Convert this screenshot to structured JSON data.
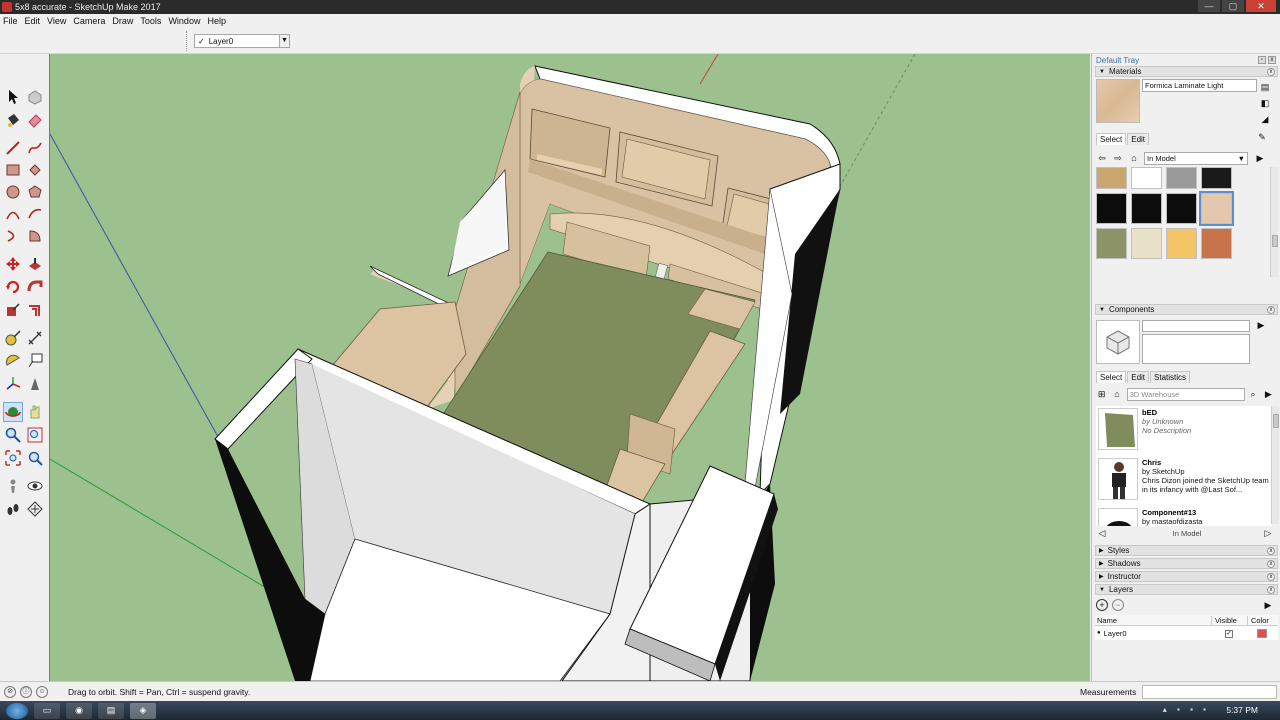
{
  "window": {
    "title": "5x8 accurate - SketchUp Make 2017",
    "minimize": "—",
    "maximize": "▢",
    "close": "✕"
  },
  "menu": [
    "File",
    "Edit",
    "View",
    "Camera",
    "Draw",
    "Tools",
    "Window",
    "Help"
  ],
  "layer_toolbar": {
    "check": "✓",
    "current_layer": "Layer0"
  },
  "tray": {
    "title": "Default Tray",
    "materials": {
      "header": "Materials",
      "material_name": "Formica Laminate Light",
      "tab_select": "Select",
      "tab_edit": "Edit",
      "collection": "In Model",
      "swatch_colors": [
        "#c9a56f",
        "#ffffff",
        "#9a9a9a",
        "#1a1a1a",
        "#0c0c0c",
        "#0c0c0c",
        "#0c0c0c",
        "#e4c8ad",
        "#8c9468",
        "#e9e2c8",
        "#f3c566",
        "#c8744a"
      ]
    },
    "components": {
      "header": "Components",
      "tab_select": "Select",
      "tab_edit": "Edit",
      "tab_statistics": "Statistics",
      "search_placeholder": "3D Warehouse",
      "footer_label": "In Model",
      "items": [
        {
          "name": "bED",
          "by": "by Unknown",
          "desc": "No Description"
        },
        {
          "name": "Chris",
          "by": "by SketchUp",
          "desc": "Chris Dizon joined the SketchUp team in its infancy with @Last Sof..."
        },
        {
          "name": "Component#13",
          "by": "by mastaofdizasta",
          "desc": ""
        }
      ]
    },
    "collapsed_panels": [
      "Styles",
      "Shadows",
      "Instructor"
    ],
    "layers": {
      "header": "Layers",
      "col_name": "Name",
      "col_visible": "Visible",
      "col_color": "Color",
      "rows": [
        {
          "name": "Layer0",
          "visible": "✓",
          "color": "#e05050"
        }
      ]
    }
  },
  "status": {
    "message": "Drag to orbit. Shift = Pan, Ctrl = suspend gravity.",
    "measurements_label": "Measurements"
  },
  "taskbar": {
    "clock": "5:37 PM"
  }
}
